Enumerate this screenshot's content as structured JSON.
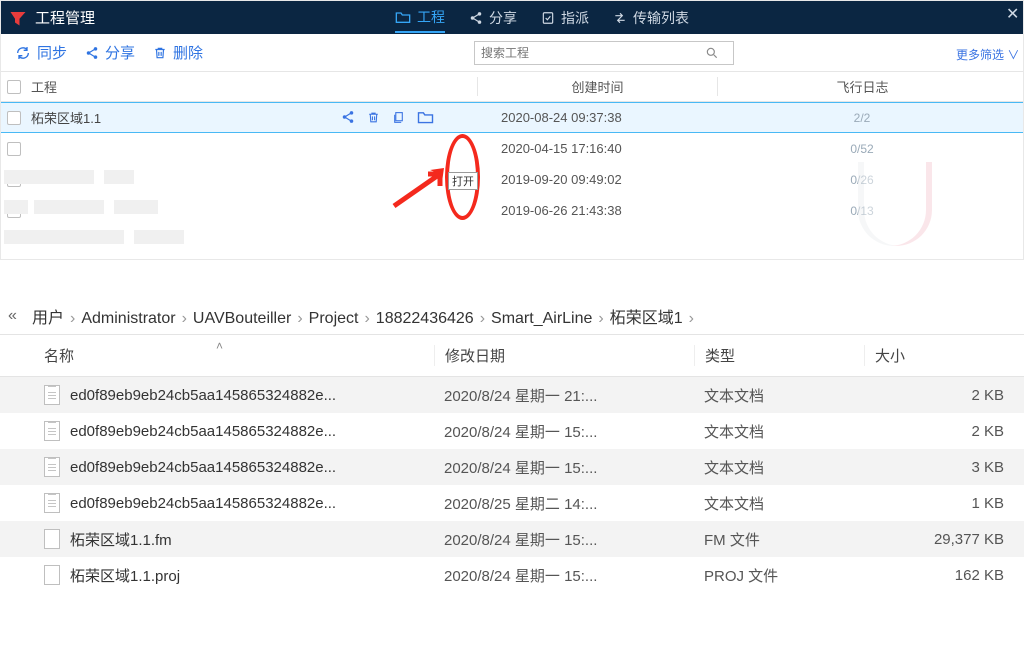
{
  "titlebar": {
    "title": "工程管理"
  },
  "top_menu": [
    {
      "label": "工程",
      "active": true
    },
    {
      "label": "分享"
    },
    {
      "label": "指派"
    },
    {
      "label": "传输列表"
    }
  ],
  "toolbar": {
    "sync": "同步",
    "share": "分享",
    "delete": "删除",
    "search_placeholder": "搜索工程",
    "more_filter": "更多筛选"
  },
  "columns": {
    "project": "工程",
    "created": "创建时间",
    "flight_log": "飞行日志"
  },
  "rows": [
    {
      "name": "柘荣区域1.1",
      "created": "2020-08-24 09:37:38",
      "log": "2/2",
      "selected": true,
      "show_actions": true
    },
    {
      "name": "",
      "created": "2020-04-15 17:16:40",
      "log": "0/52"
    },
    {
      "name": "",
      "created": "2019-09-20 09:49:02",
      "log": "0/26"
    },
    {
      "name": "",
      "created": "2019-06-26 21:43:38",
      "log": "0/13"
    }
  ],
  "open_tooltip": "打开",
  "breadcrumbs": [
    "用户",
    "Administrator",
    "UAVBouteiller",
    "Project",
    "18822436426",
    "Smart_AirLine",
    "柘荣区域1"
  ],
  "explorer_columns": {
    "name": "名称",
    "date": "修改日期",
    "type": "类型",
    "size": "大小"
  },
  "files": [
    {
      "name": "ed0f89eb9eb24cb5aa145865324882e...",
      "date": "2020/8/24 星期一 21:...",
      "type": "文本文档",
      "size": "2 KB",
      "icon": "txt"
    },
    {
      "name": "ed0f89eb9eb24cb5aa145865324882e...",
      "date": "2020/8/24 星期一 15:...",
      "type": "文本文档",
      "size": "2 KB",
      "icon": "txt"
    },
    {
      "name": "ed0f89eb9eb24cb5aa145865324882e...",
      "date": "2020/8/24 星期一 15:...",
      "type": "文本文档",
      "size": "3 KB",
      "icon": "txt"
    },
    {
      "name": "ed0f89eb9eb24cb5aa145865324882e...",
      "date": "2020/8/25 星期二 14:...",
      "type": "文本文档",
      "size": "1 KB",
      "icon": "txt"
    },
    {
      "name": "柘荣区域1.1.fm",
      "date": "2020/8/24 星期一 15:...",
      "type": "FM 文件",
      "size": "29,377 KB",
      "icon": "blank"
    },
    {
      "name": "柘荣区域1.1.proj",
      "date": "2020/8/24 星期一 15:...",
      "type": "PROJ 文件",
      "size": "162 KB",
      "icon": "blank"
    }
  ]
}
